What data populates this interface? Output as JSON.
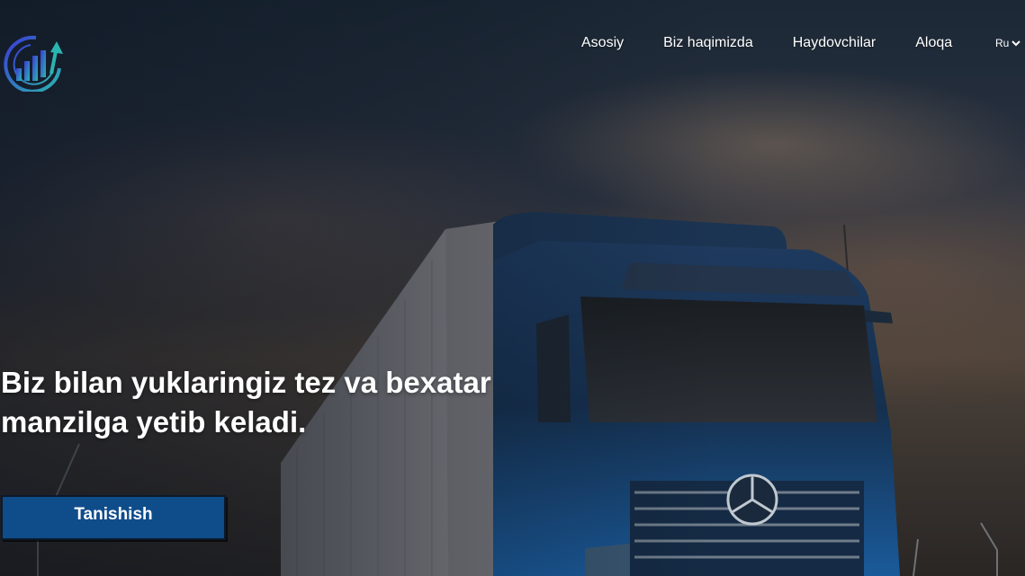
{
  "nav": {
    "items": [
      {
        "label": "Asosiy"
      },
      {
        "label": "Biz haqimizda"
      },
      {
        "label": "Haydovchilar"
      },
      {
        "label": "Aloqa"
      }
    ],
    "language": "Ru"
  },
  "hero": {
    "headline_line1": "Biz bilan yuklaringiz tez va bexatar",
    "headline_line2": "manzilga yetib keladi.",
    "cta_label": "Tanishish"
  },
  "colors": {
    "accent": "#0f4c8a",
    "logo_gradient_start": "#3b3bd6",
    "logo_gradient_end": "#2bb5b0"
  },
  "icons": {
    "logo": "growth-chart-logo",
    "language_toggle": "chevron-down-icon",
    "hero_image": "truck-image"
  }
}
